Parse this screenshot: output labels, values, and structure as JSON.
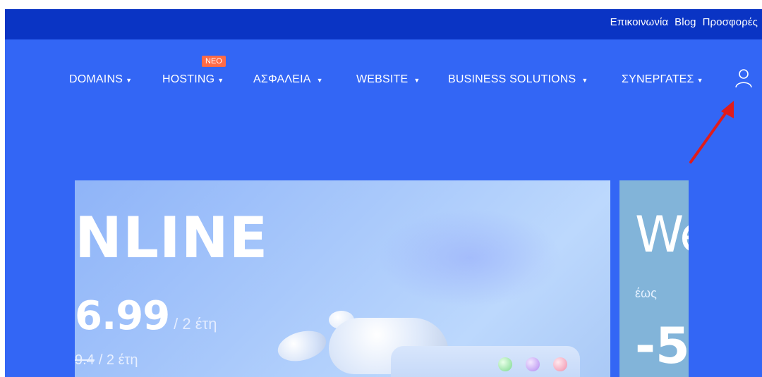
{
  "top_links": [
    "Επικοινωνία",
    "Blog",
    "Προσφορές"
  ],
  "nav": {
    "items": [
      "DOMAINS",
      "HOSTING",
      "ΑΣΦΑΛΕΙΑ",
      "WEBSITE",
      "BUSINESS SOLUTIONS",
      "ΣΥΝΕΡΓΑΤΕΣ"
    ],
    "caret": "▼",
    "badge": "ΝΕΟ"
  },
  "hero_main": {
    "title": "NLINE",
    "price": "6.99",
    "price_unit": "/ 2 έτη",
    "old_price": "9.4",
    "old_unit": "/ 2 έτη"
  },
  "hero_side": {
    "title": "We",
    "subtitle": "έως",
    "big": "-5"
  },
  "icons": {
    "user": "user-icon",
    "annotation": "red-arrow-annotation"
  },
  "colors": {
    "topbar": "#0a34c4",
    "header": "#3366f5",
    "badge": "#ff6b47",
    "arrow": "#e01c1c"
  }
}
